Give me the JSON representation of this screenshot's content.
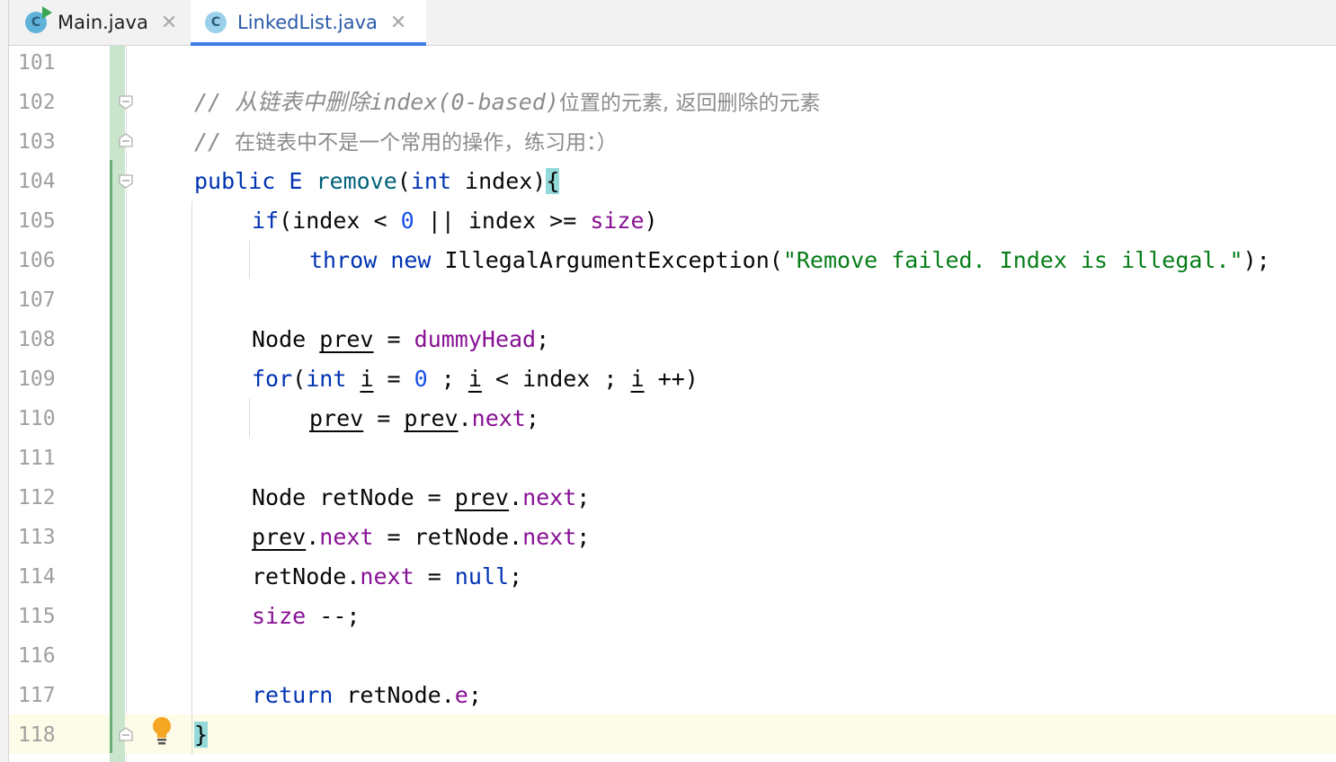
{
  "tabs": [
    {
      "label": "Main.java",
      "icon": "class-run-icon",
      "active": false
    },
    {
      "label": "LinkedList.java",
      "icon": "class-icon",
      "active": true
    }
  ],
  "icon_letter": "C",
  "close_glyph": "✕",
  "line_numbers": [
    "101",
    "102",
    "103",
    "104",
    "105",
    "106",
    "107",
    "108",
    "109",
    "110",
    "111",
    "112",
    "113",
    "114",
    "115",
    "116",
    "117",
    "118"
  ],
  "code": {
    "l102_cmt1": "// 从链表中删除",
    "l102_cmt2": "index(0-based)",
    "l102_cmt3": "位置的元素, 返回删除的元素",
    "l103_cmt1": "// ",
    "l103_cmt2": "在链表中不是一个常用的操作，练习用：）",
    "l104_public": "public",
    "l104_type": " E ",
    "l104_name": "remove",
    "l104_paren": "(",
    "l104_int": "int",
    "l104_rest": " index)",
    "l104_brace": "{",
    "l105_if": "if",
    "l105_a": "(index < ",
    "l105_zero": "0",
    "l105_b": " || index >= ",
    "l105_size": "size",
    "l105_c": ")",
    "l106_throw": "throw",
    "l106_sp": " ",
    "l106_new": "new",
    "l106_cls": " IllegalArgumentException(",
    "l106_str": "\"Remove failed. Index is illegal.\"",
    "l106_end": ");",
    "l108_a": "Node ",
    "l108_prev": "prev",
    "l108_b": " = ",
    "l108_dh": "dummyHead",
    "l108_c": ";",
    "l109_for": "for",
    "l109_a": "(",
    "l109_int": "int",
    "l109_sp": " ",
    "l109_i1": "i",
    "l109_b": " = ",
    "l109_zero": "0",
    "l109_c": " ; ",
    "l109_i2": "i",
    "l109_d": " < index ; ",
    "l109_i3": "i",
    "l109_e": " ++)",
    "l110_prev1": "prev",
    "l110_a": " = ",
    "l110_prev2": "prev",
    "l110_dot": ".",
    "l110_next": "next",
    "l110_semi": ";",
    "l112_a": "Node retNode = ",
    "l112_prev": "prev",
    "l112_dot": ".",
    "l112_next": "next",
    "l112_semi": ";",
    "l113_prev": "prev",
    "l113_dot": ".",
    "l113_next": "next",
    "l113_a": " = retNode.",
    "l113_next2": "next",
    "l113_semi": ";",
    "l114_a": "retNode.",
    "l114_next": "next",
    "l114_b": " = ",
    "l114_null": "null",
    "l114_semi": ";",
    "l115_size": "size",
    "l115_a": " --;",
    "l117_return": "return",
    "l117_a": " retNode.",
    "l117_e": "e",
    "l117_semi": ";",
    "l118_brace": "}"
  },
  "colors": {
    "keyword": "#0033b3",
    "number": "#1750eb",
    "string": "#067d17",
    "field": "#871094",
    "comment": "#8c8c8c",
    "method": "#00627a",
    "change_marker": "#c9e5cc",
    "tab_underline": "#3d7ee3"
  }
}
